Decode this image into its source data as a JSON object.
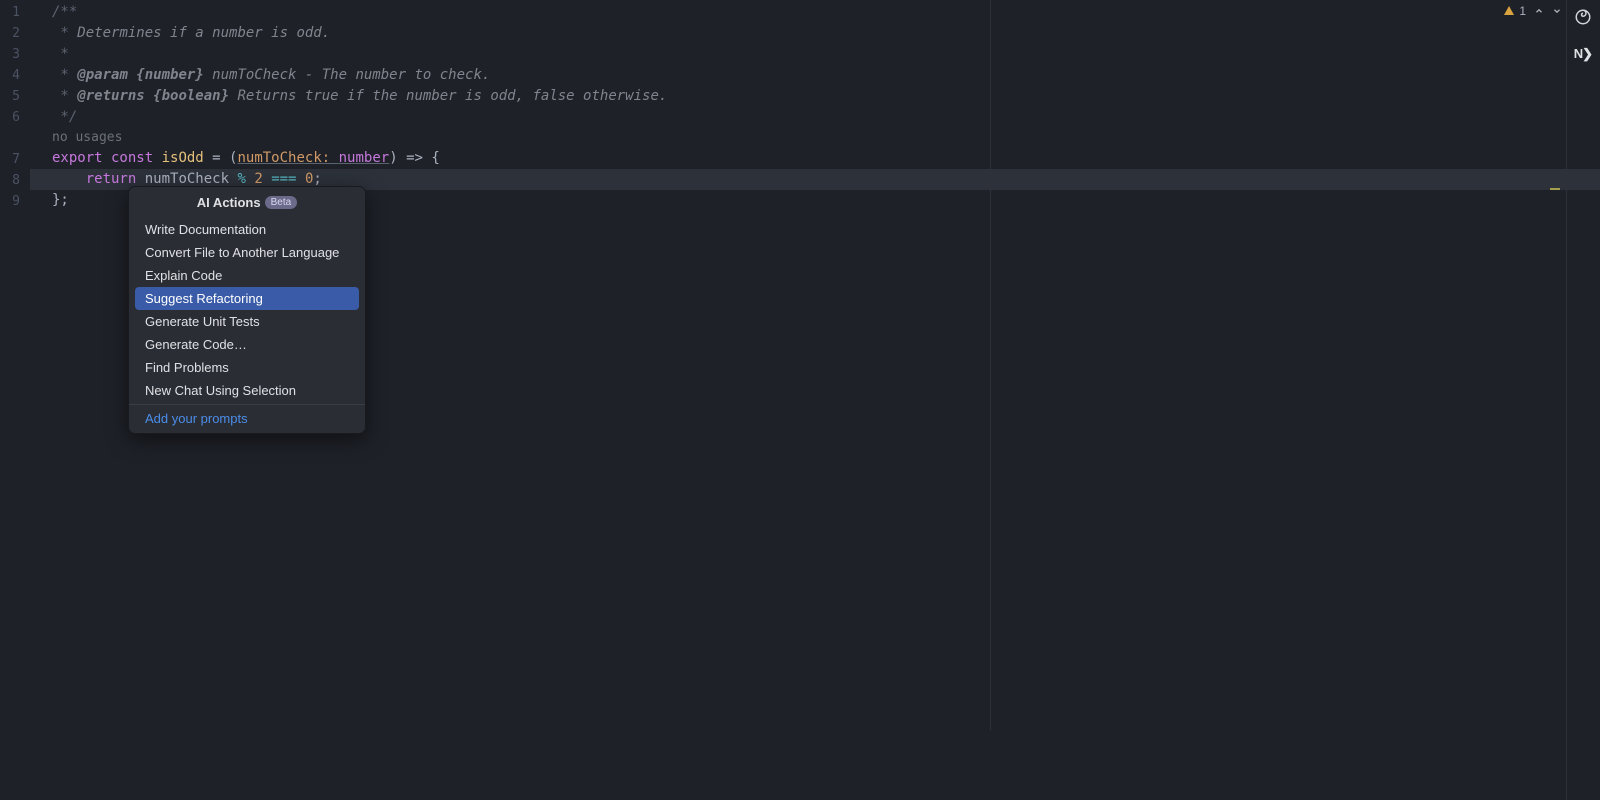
{
  "gutter": {
    "lines": [
      "1",
      "2",
      "3",
      "4",
      "5",
      "6",
      "7",
      "8",
      "9"
    ]
  },
  "code": {
    "line1": "/**",
    "line2_prefix": " * ",
    "line2_text": "Determines if a number is odd.",
    "line3": " *",
    "line4_prefix": " * ",
    "line4_tag": "@param",
    "line4_type": " {number}",
    "line4_name": " numToCheck",
    "line4_desc": " - The number to check.",
    "line5_prefix": " * ",
    "line5_tag": "@returns",
    "line5_type": " {boolean}",
    "line5_desc": " Returns true if the number is odd, false otherwise.",
    "line6": " */",
    "no_usages": "no usages",
    "l7_export": "export",
    "l7_const": " const",
    "l7_fn": " isOdd",
    "l7_eq": " = ",
    "l7_open": "(",
    "l7_param": "numToCheck: ",
    "l7_type": "number",
    "l7_close": ")",
    "l7_arrow": " => ",
    "l7_brace": "{",
    "l8_indent": "    ",
    "l8_return": "return",
    "l8_var": " numToCheck ",
    "l8_mod": "%",
    "l8_sp1": " ",
    "l8_n2": "2",
    "l8_sp2": " ",
    "l8_eqeq": "===",
    "l8_sp3": " ",
    "l8_n0": "0",
    "l8_semi": ";",
    "l9": "};"
  },
  "popup": {
    "title": "AI Actions",
    "badge": "Beta",
    "items": [
      "Write Documentation",
      "Convert File to Another Language",
      "Explain Code",
      "Suggest Refactoring",
      "Generate Unit Tests",
      "Generate Code…",
      "Find Problems",
      "New Chat Using Selection"
    ],
    "selected_index": 3,
    "footer_link": "Add your prompts"
  },
  "indicators": {
    "warn_count": "1",
    "nx_label": "N❯"
  }
}
